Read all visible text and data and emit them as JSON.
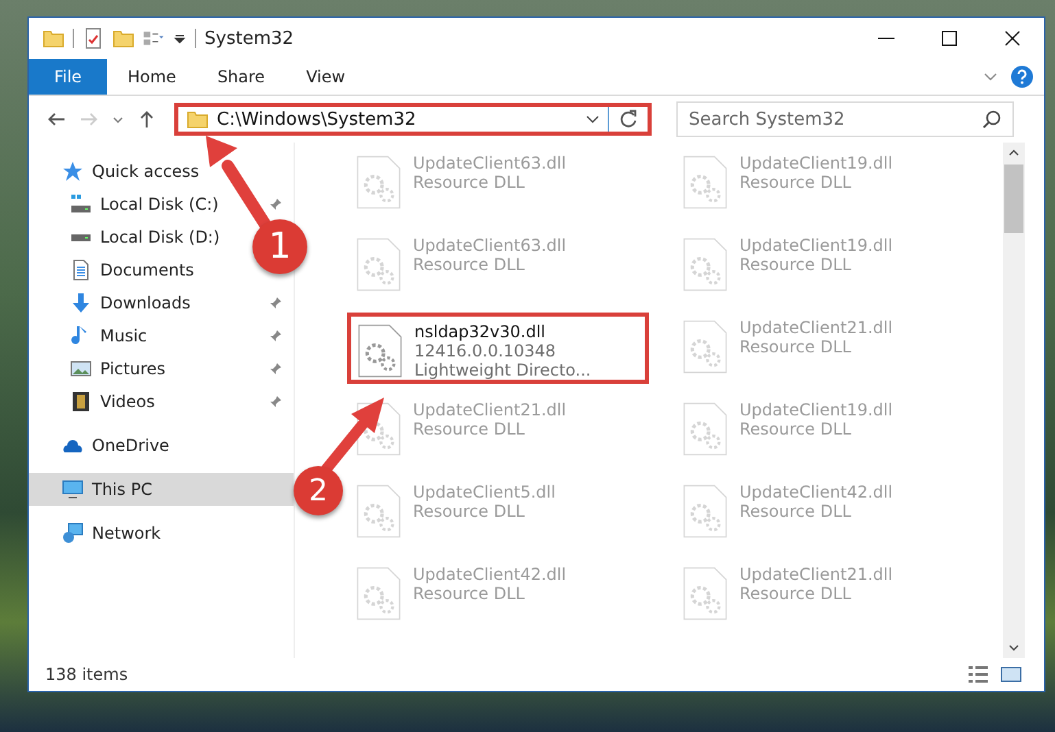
{
  "window": {
    "title": "System32"
  },
  "ribbon": {
    "tabs": [
      {
        "label": "File",
        "kind": "menu"
      },
      {
        "label": "Home",
        "kind": "tab"
      },
      {
        "label": "Share",
        "kind": "tab"
      },
      {
        "label": "View",
        "kind": "tab"
      }
    ]
  },
  "address": {
    "path": "C:\\Windows\\System32",
    "highlighted": true
  },
  "search": {
    "placeholder": "Search System32"
  },
  "sidebar": {
    "items": [
      {
        "label": "Quick access",
        "kind": "star",
        "selected": false,
        "children": [
          {
            "label": "Local Disk (C:)",
            "kind": "drive-c",
            "pinned": true
          },
          {
            "label": "Local Disk (D:)",
            "kind": "drive",
            "pinned": false
          },
          {
            "label": "Documents",
            "kind": "documents",
            "pinned": false
          },
          {
            "label": "Downloads",
            "kind": "downloads",
            "pinned": true
          },
          {
            "label": "Music",
            "kind": "music",
            "pinned": true
          },
          {
            "label": "Pictures",
            "kind": "pictures",
            "pinned": true
          },
          {
            "label": "Videos",
            "kind": "videos",
            "pinned": true
          }
        ]
      },
      {
        "label": "OneDrive",
        "kind": "cloud",
        "selected": false
      },
      {
        "label": "This PC",
        "kind": "pc",
        "selected": true
      },
      {
        "label": "Network",
        "kind": "network",
        "selected": false
      }
    ]
  },
  "files": [
    {
      "name": "UpdateClient63.dll",
      "lines": [
        "Resource DLL"
      ],
      "highlighted": false,
      "faded": true
    },
    {
      "name": "UpdateClient19.dll",
      "lines": [
        "Resource DLL"
      ],
      "highlighted": false,
      "faded": true
    },
    {
      "name": "UpdateClient63.dll",
      "lines": [
        "Resource DLL"
      ],
      "highlighted": false,
      "faded": true
    },
    {
      "name": "UpdateClient19.dll",
      "lines": [
        "Resource DLL"
      ],
      "highlighted": false,
      "faded": true
    },
    {
      "name": "nsldap32v30.dll",
      "lines": [
        "12416.0.0.10348",
        "Lightweight Directo..."
      ],
      "highlighted": true,
      "faded": false
    },
    {
      "name": "UpdateClient21.dll",
      "lines": [
        "Resource DLL"
      ],
      "highlighted": false,
      "faded": true
    },
    {
      "name": "UpdateClient21.dll",
      "lines": [
        "Resource DLL"
      ],
      "highlighted": false,
      "faded": true
    },
    {
      "name": "UpdateClient19.dll",
      "lines": [
        "Resource DLL"
      ],
      "highlighted": false,
      "faded": true
    },
    {
      "name": "UpdateClient5.dll",
      "lines": [
        "Resource DLL"
      ],
      "highlighted": false,
      "faded": true
    },
    {
      "name": "UpdateClient42.dll",
      "lines": [
        "Resource DLL"
      ],
      "highlighted": false,
      "faded": true
    },
    {
      "name": "UpdateClient42.dll",
      "lines": [
        "Resource DLL"
      ],
      "highlighted": false,
      "faded": true
    },
    {
      "name": "UpdateClient21.dll",
      "lines": [
        "Resource DLL"
      ],
      "highlighted": false,
      "faded": true
    }
  ],
  "status_bar": {
    "count": "138 items"
  },
  "callouts": [
    {
      "number": "1"
    },
    {
      "number": "2"
    }
  ]
}
